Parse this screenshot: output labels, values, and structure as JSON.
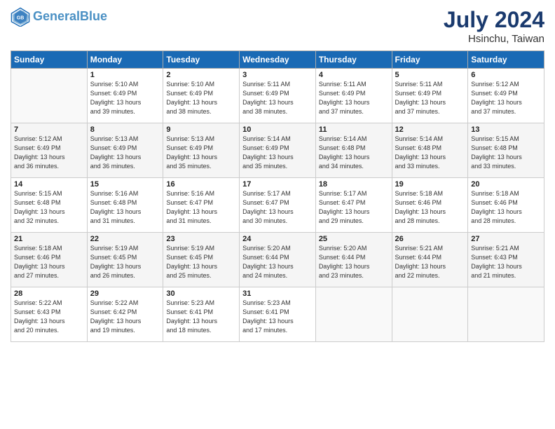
{
  "header": {
    "logo_line1": "General",
    "logo_line2": "Blue",
    "month": "July 2024",
    "location": "Hsinchu, Taiwan"
  },
  "weekdays": [
    "Sunday",
    "Monday",
    "Tuesday",
    "Wednesday",
    "Thursday",
    "Friday",
    "Saturday"
  ],
  "weeks": [
    [
      {
        "day": "",
        "info": ""
      },
      {
        "day": "1",
        "info": "Sunrise: 5:10 AM\nSunset: 6:49 PM\nDaylight: 13 hours\nand 39 minutes."
      },
      {
        "day": "2",
        "info": "Sunrise: 5:10 AM\nSunset: 6:49 PM\nDaylight: 13 hours\nand 38 minutes."
      },
      {
        "day": "3",
        "info": "Sunrise: 5:11 AM\nSunset: 6:49 PM\nDaylight: 13 hours\nand 38 minutes."
      },
      {
        "day": "4",
        "info": "Sunrise: 5:11 AM\nSunset: 6:49 PM\nDaylight: 13 hours\nand 37 minutes."
      },
      {
        "day": "5",
        "info": "Sunrise: 5:11 AM\nSunset: 6:49 PM\nDaylight: 13 hours\nand 37 minutes."
      },
      {
        "day": "6",
        "info": "Sunrise: 5:12 AM\nSunset: 6:49 PM\nDaylight: 13 hours\nand 37 minutes."
      }
    ],
    [
      {
        "day": "7",
        "info": "Sunrise: 5:12 AM\nSunset: 6:49 PM\nDaylight: 13 hours\nand 36 minutes."
      },
      {
        "day": "8",
        "info": "Sunrise: 5:13 AM\nSunset: 6:49 PM\nDaylight: 13 hours\nand 36 minutes."
      },
      {
        "day": "9",
        "info": "Sunrise: 5:13 AM\nSunset: 6:49 PM\nDaylight: 13 hours\nand 35 minutes."
      },
      {
        "day": "10",
        "info": "Sunrise: 5:14 AM\nSunset: 6:49 PM\nDaylight: 13 hours\nand 35 minutes."
      },
      {
        "day": "11",
        "info": "Sunrise: 5:14 AM\nSunset: 6:48 PM\nDaylight: 13 hours\nand 34 minutes."
      },
      {
        "day": "12",
        "info": "Sunrise: 5:14 AM\nSunset: 6:48 PM\nDaylight: 13 hours\nand 33 minutes."
      },
      {
        "day": "13",
        "info": "Sunrise: 5:15 AM\nSunset: 6:48 PM\nDaylight: 13 hours\nand 33 minutes."
      }
    ],
    [
      {
        "day": "14",
        "info": "Sunrise: 5:15 AM\nSunset: 6:48 PM\nDaylight: 13 hours\nand 32 minutes."
      },
      {
        "day": "15",
        "info": "Sunrise: 5:16 AM\nSunset: 6:48 PM\nDaylight: 13 hours\nand 31 minutes."
      },
      {
        "day": "16",
        "info": "Sunrise: 5:16 AM\nSunset: 6:47 PM\nDaylight: 13 hours\nand 31 minutes."
      },
      {
        "day": "17",
        "info": "Sunrise: 5:17 AM\nSunset: 6:47 PM\nDaylight: 13 hours\nand 30 minutes."
      },
      {
        "day": "18",
        "info": "Sunrise: 5:17 AM\nSunset: 6:47 PM\nDaylight: 13 hours\nand 29 minutes."
      },
      {
        "day": "19",
        "info": "Sunrise: 5:18 AM\nSunset: 6:46 PM\nDaylight: 13 hours\nand 28 minutes."
      },
      {
        "day": "20",
        "info": "Sunrise: 5:18 AM\nSunset: 6:46 PM\nDaylight: 13 hours\nand 28 minutes."
      }
    ],
    [
      {
        "day": "21",
        "info": "Sunrise: 5:18 AM\nSunset: 6:46 PM\nDaylight: 13 hours\nand 27 minutes."
      },
      {
        "day": "22",
        "info": "Sunrise: 5:19 AM\nSunset: 6:45 PM\nDaylight: 13 hours\nand 26 minutes."
      },
      {
        "day": "23",
        "info": "Sunrise: 5:19 AM\nSunset: 6:45 PM\nDaylight: 13 hours\nand 25 minutes."
      },
      {
        "day": "24",
        "info": "Sunrise: 5:20 AM\nSunset: 6:44 PM\nDaylight: 13 hours\nand 24 minutes."
      },
      {
        "day": "25",
        "info": "Sunrise: 5:20 AM\nSunset: 6:44 PM\nDaylight: 13 hours\nand 23 minutes."
      },
      {
        "day": "26",
        "info": "Sunrise: 5:21 AM\nSunset: 6:44 PM\nDaylight: 13 hours\nand 22 minutes."
      },
      {
        "day": "27",
        "info": "Sunrise: 5:21 AM\nSunset: 6:43 PM\nDaylight: 13 hours\nand 21 minutes."
      }
    ],
    [
      {
        "day": "28",
        "info": "Sunrise: 5:22 AM\nSunset: 6:43 PM\nDaylight: 13 hours\nand 20 minutes."
      },
      {
        "day": "29",
        "info": "Sunrise: 5:22 AM\nSunset: 6:42 PM\nDaylight: 13 hours\nand 19 minutes."
      },
      {
        "day": "30",
        "info": "Sunrise: 5:23 AM\nSunset: 6:41 PM\nDaylight: 13 hours\nand 18 minutes."
      },
      {
        "day": "31",
        "info": "Sunrise: 5:23 AM\nSunset: 6:41 PM\nDaylight: 13 hours\nand 17 minutes."
      },
      {
        "day": "",
        "info": ""
      },
      {
        "day": "",
        "info": ""
      },
      {
        "day": "",
        "info": ""
      }
    ]
  ]
}
